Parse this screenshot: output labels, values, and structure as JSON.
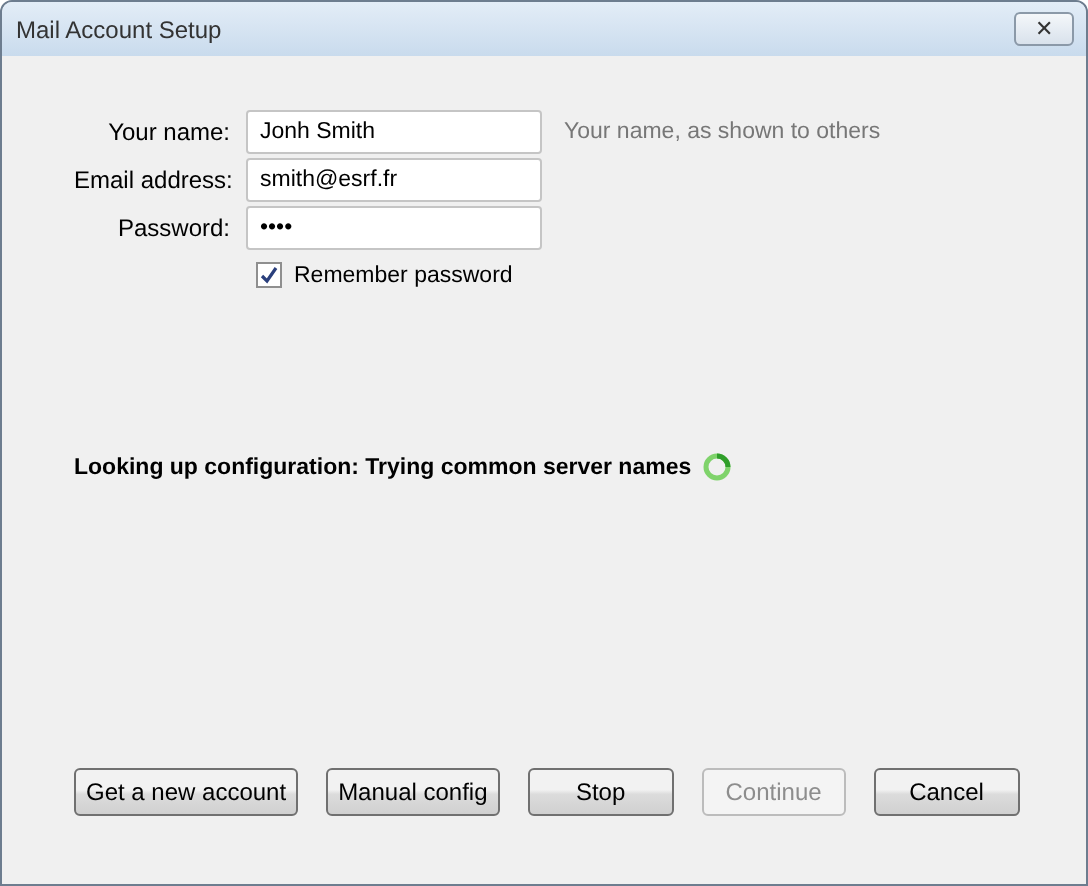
{
  "window": {
    "title": "Mail Account Setup",
    "close_glyph": "✕"
  },
  "fields": [
    {
      "label": "Your name:",
      "value": "Jonh Smith",
      "hint": "Your name, as shown to others"
    },
    {
      "label": "Email address:",
      "value": "smith@esrf.fr"
    },
    {
      "label": "Password:",
      "value": "••••"
    }
  ],
  "remember_password": {
    "label": "Remember password",
    "checked": true
  },
  "status": {
    "text": "Looking up configuration: Trying common server names",
    "busy": true
  },
  "buttons": [
    {
      "label": "Get a new account",
      "disabled": false
    },
    {
      "label": "Manual config",
      "disabled": false
    },
    {
      "label": "Stop",
      "disabled": false
    },
    {
      "label": "Continue",
      "disabled": true
    },
    {
      "label": "Cancel",
      "disabled": false
    }
  ]
}
